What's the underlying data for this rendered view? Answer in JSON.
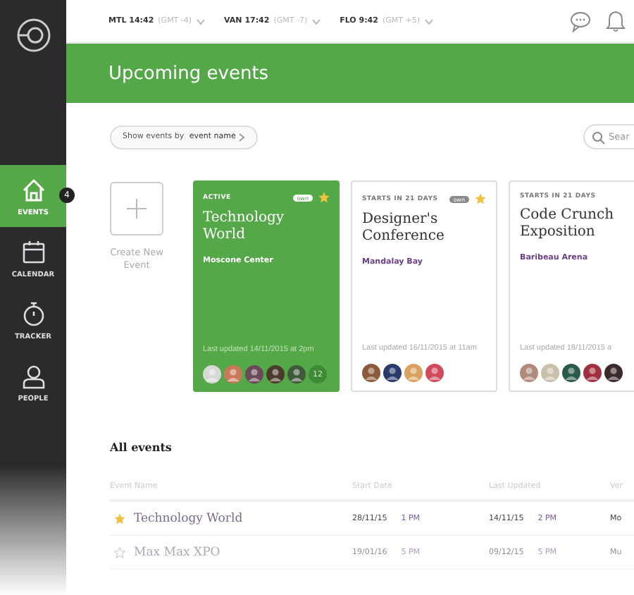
{
  "sidebar": {
    "items": [
      {
        "label": "EVENTS",
        "selected": true,
        "badge": "4"
      },
      {
        "label": "CALENDAR",
        "selected": false
      },
      {
        "label": "TRACKER",
        "selected": false
      },
      {
        "label": "PEOPLE",
        "selected": false
      }
    ]
  },
  "clocks": [
    {
      "city": "MTL 14:42",
      "offset": "(GMT -4)"
    },
    {
      "city": "VAN 17:42",
      "offset": "(GMT -7)"
    },
    {
      "city": "FLO 9:42",
      "offset": "(GMT +5)"
    }
  ],
  "header": {
    "title": "Upcoming events"
  },
  "filter": {
    "prefix": "Show events by ",
    "value": "event name"
  },
  "search": {
    "placeholder": "Sear"
  },
  "create": {
    "label": "Create New Event"
  },
  "cards": [
    {
      "kind": "active",
      "status": "ACTIVE",
      "badge": "own",
      "starred": true,
      "title": "Technology World",
      "venue": "Moscone Center",
      "updated": "Last updated 14/11/2015 at 2pm",
      "avatars": [
        {
          "color": "#d8d8d8"
        },
        {
          "color": "#c97a5a"
        },
        {
          "color": "#6a4a5a"
        },
        {
          "color": "#4a3a2a"
        },
        {
          "color": "#3f5a3a"
        }
      ],
      "more": "12"
    },
    {
      "kind": "upcoming",
      "status": "STARTS IN 21 DAYS",
      "badge": "own",
      "starred": true,
      "title": "Designer's Conference",
      "venue": "Mandalay Bay",
      "updated": "Last updated 16/11/2015 at 11am",
      "avatars": [
        {
          "color": "#8a5a3a"
        },
        {
          "color": "#2a3a6a"
        },
        {
          "color": "#d9a060"
        },
        {
          "color": "#d04a5a"
        }
      ]
    },
    {
      "kind": "upcoming",
      "status": "STARTS IN 21 DAYS",
      "starred": false,
      "title": "Code Crunch Exposition",
      "venue": "Baribeau Arena",
      "updated": "Last updated 18/11/2015 a",
      "avatars": [
        {
          "color": "#b08a7a"
        },
        {
          "color": "#c8c0a8"
        },
        {
          "color": "#2a5a4a"
        },
        {
          "color": "#a03040"
        },
        {
          "color": "#3a2a2a"
        }
      ]
    }
  ],
  "all_events": {
    "title": "All events",
    "columns": [
      "Event Name",
      "Start Date",
      "Last Updated",
      "Ver"
    ],
    "rows": [
      {
        "starred": true,
        "dimmed": false,
        "name": "Technology World",
        "start_date": "28/11/15",
        "start_time": "1 PM",
        "updated_date": "14/11/15",
        "updated_time": "2 PM",
        "venue": "Mo"
      },
      {
        "starred": false,
        "dimmed": true,
        "name": "Max Max XPO",
        "start_date": "19/01/16",
        "start_time": "5 PM",
        "updated_date": "09/12/15",
        "updated_time": "5 PM",
        "venue": "Mu"
      }
    ]
  }
}
